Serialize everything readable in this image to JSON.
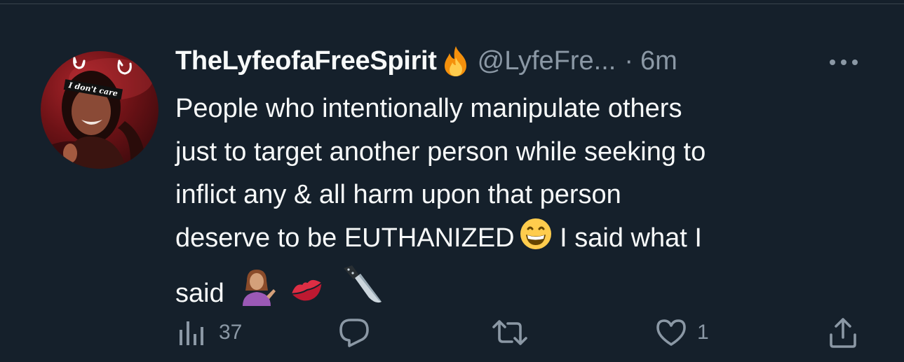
{
  "tweet": {
    "display_name": "TheLyfeofaFreeSpirit",
    "handle": "@LyfeFre...",
    "separator": "·",
    "time": "6m",
    "avatar": {
      "caption": "I don't care"
    },
    "text_lines": [
      "People who intentionally manipulate others",
      "just to target another person while seeking to",
      "inflict any & all harm upon that person",
      "deserve to be EUTHANIZED",
      " I said what I",
      "said"
    ],
    "emojis": [
      "fire",
      "grinning-face",
      "person-tipping-hand",
      "kiss-mark",
      "kitchen-knife"
    ]
  },
  "actions": {
    "views_count": "37",
    "reply_count": "",
    "retweet_count": "",
    "like_count": "1"
  },
  "colors": {
    "background": "#15202b",
    "text_primary": "#f7f9f9",
    "text_secondary": "#8b98a5",
    "divider": "#38444d"
  }
}
